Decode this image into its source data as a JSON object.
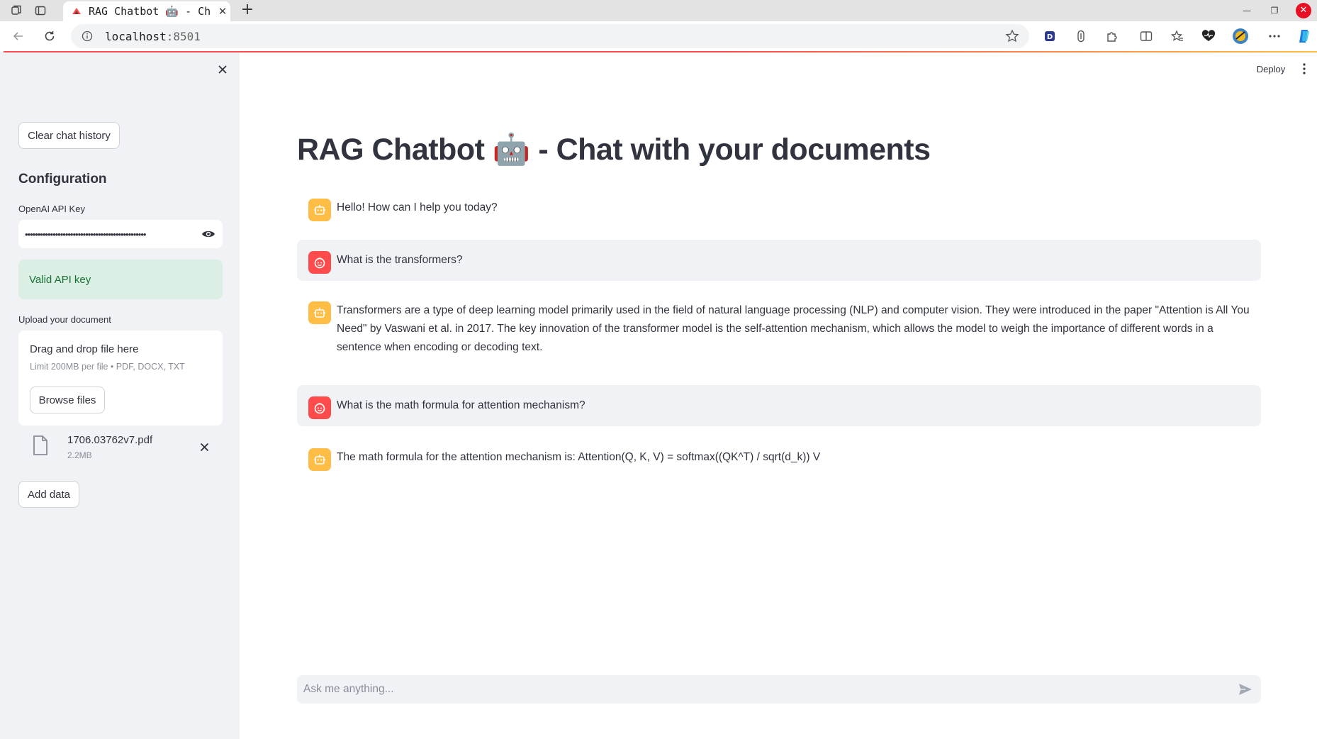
{
  "browser": {
    "tab_title": "RAG Chatbot 🤖 - Ch",
    "url_host": "localhost",
    "url_port": ":8501"
  },
  "header": {
    "deploy_label": "Deploy"
  },
  "sidebar": {
    "clear_button": "Clear chat history",
    "heading": "Configuration",
    "api_key_label": "OpenAI API Key",
    "api_key_masked": "••••••••••••••••••••••••••••••••••••••••••••••••",
    "success_text": "Valid API key",
    "upload_label": "Upload your document",
    "dropzone_title": "Drag and drop file here",
    "dropzone_limit": "Limit 200MB per file • PDF, DOCX, TXT",
    "browse_button": "Browse files",
    "file": {
      "name": "1706.03762v7.pdf",
      "size": "2.2MB"
    },
    "add_data_button": "Add data"
  },
  "main": {
    "title": "RAG Chatbot 🤖 - Chat with your documents",
    "messages": [
      {
        "role": "assistant",
        "text": "Hello! How can I help you today?"
      },
      {
        "role": "user",
        "text": "What is the transformers?"
      },
      {
        "role": "assistant",
        "text": "Transformers are a type of deep learning model primarily used in the field of natural language processing (NLP) and computer vision. They were introduced in the paper \"Attention is All You Need\" by Vaswani et al. in 2017. The key innovation of the transformer model is the self-attention mechanism, which allows the model to weigh the importance of different words in a sentence when encoding or decoding text."
      },
      {
        "role": "user",
        "text": "What is the math formula for attention mechanism?"
      },
      {
        "role": "assistant",
        "text": "The math formula for the attention mechanism is: Attention(Q, K, V) = softmax((QK^T) / sqrt(d_k)) V"
      }
    ],
    "chat_placeholder": "Ask me anything..."
  },
  "colors": {
    "primary": "#ff4b4b",
    "assistant_avatar": "#ffbd45",
    "user_avatar": "#ff4b4b",
    "sidebar_bg": "#f0f2f6",
    "success_bg": "#dbefe4",
    "success_text": "#177233"
  }
}
